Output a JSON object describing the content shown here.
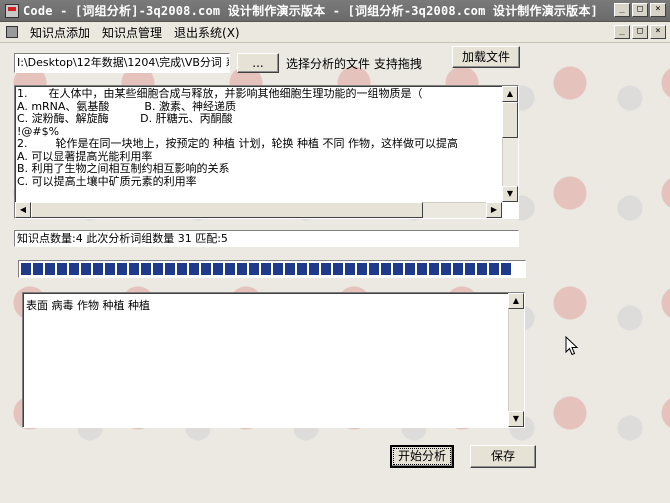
{
  "window": {
    "title": "Code - [词组分析]-3q2008.com 设计制作演示版本 - [词组分析-3q2008.com 设计制作演示版本]",
    "minimize": "_",
    "maximize": "□",
    "close": "×"
  },
  "menu": {
    "items": [
      "知识点添加",
      "知识点管理",
      "退出系统(X)"
    ]
  },
  "file": {
    "path": "I:\\Desktop\\12年数据\\1204\\完成\\VB分词 系",
    "browse_label": "...",
    "hint": "选择分析的文件 支持拖拽",
    "load_label": "加载文件"
  },
  "questions_text": "1.      在人体中，由某些细胞合成与释放，并影响其他细胞生理功能的一组物质是（\nA. mRNA、氨基酸          B. 激素、神经递质\nC. 淀粉酶、解旋酶         D. 肝糖元、丙酮酸\n!@#$%\n2.        轮作是在同一块地上，按预定的 种植 计划，轮换 种植 不同 作物，这样做可以提高\nA. 可以显著提高光能利用率\nB. 利用了生物之间相互制约相互影响的关系\nC. 可以提高土壤中矿质元素的利用率",
  "status": "知识点数量:4 此次分析词组数量 31 匹配:5",
  "progress": {
    "percent": 100
  },
  "result_text": "表面 病毒 作物 种植 种植",
  "buttons": {
    "start": "开始分析",
    "save": "保存"
  },
  "colors": {
    "progress_fill": "#1f3a8a",
    "titlebar": "#6e6e6e"
  }
}
